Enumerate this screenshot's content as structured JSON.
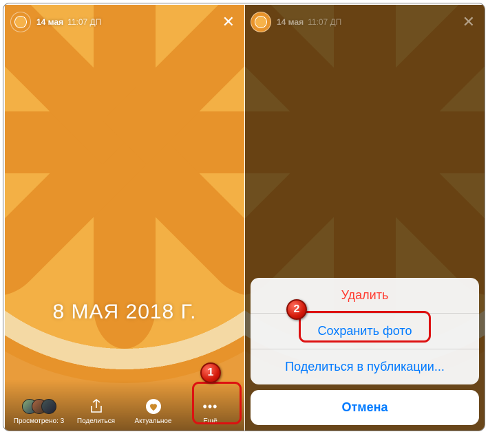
{
  "header": {
    "date": "14 мая",
    "time": "11:07 ДП"
  },
  "caption": "8 МАЯ 2018 Г.",
  "toolbar": {
    "views_label": "Просмотрено: 3",
    "share_label": "Поделиться",
    "highlight_label": "Актуальное",
    "more_label": "Ещё"
  },
  "sheet": {
    "delete": "Удалить",
    "save_photo": "Сохранить фото",
    "share_post": "Поделиться в публикации...",
    "cancel": "Отмена"
  },
  "badges": {
    "one": "1",
    "two": "2"
  }
}
